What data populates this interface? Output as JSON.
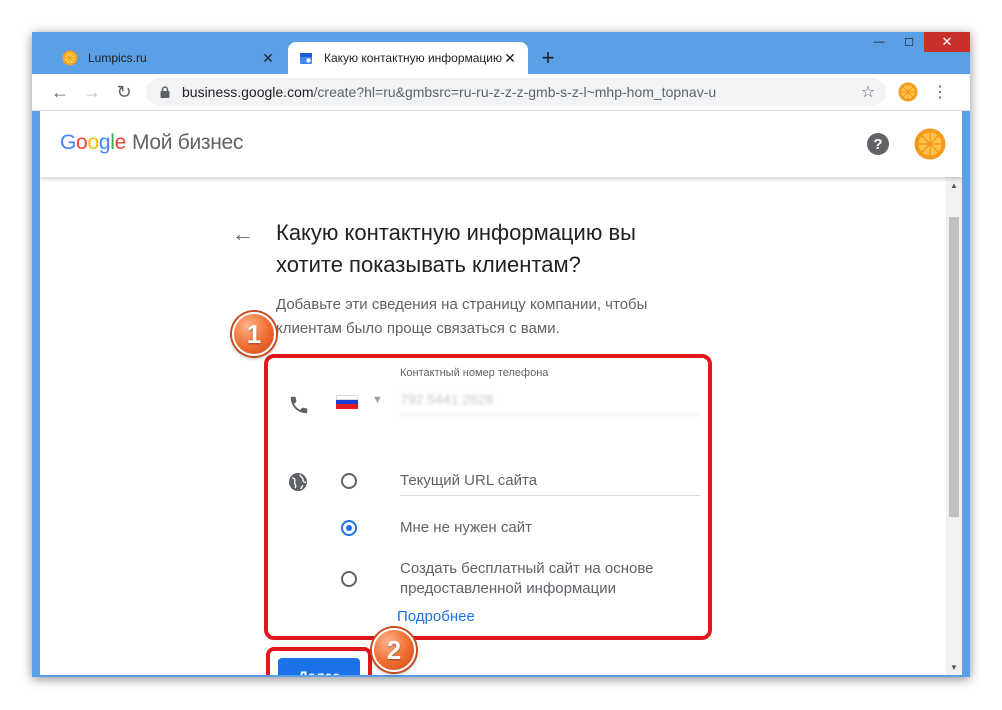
{
  "browser": {
    "tabs": [
      {
        "label": "Lumpics.ru",
        "active": false
      },
      {
        "label": "Какую контактную информацию",
        "active": true
      }
    ],
    "new_tab": "+",
    "url_host": "business.google.com",
    "url_rest": "/create?hl=ru&gmbsrc=ru-ru-z-z-z-gmb-s-z-l~mhp-hom_topnav-u",
    "window_controls": {
      "minimize": "—",
      "maximize": "☐",
      "close": "✕"
    }
  },
  "appbar": {
    "logo_letters": [
      "G",
      "o",
      "o",
      "g",
      "l",
      "e"
    ],
    "product": "Мой бизнес",
    "help": "?"
  },
  "form": {
    "heading": "Какую контактную информацию вы хотите показывать клиентам?",
    "subtext": "Добавьте эти сведения на страницу компании, чтобы клиентам было проще связаться с вами.",
    "phone_label": "Контактный номер телефона",
    "phone_value": "792 5441 2626",
    "website_options": [
      {
        "label": "Текущий URL сайта",
        "checked": false
      },
      {
        "label": "Мне не нужен сайт",
        "checked": true
      },
      {
        "label": "Создать бесплатный сайт на основе предоставленной информации",
        "checked": false
      }
    ],
    "more_link": "Подробнее",
    "next_button": "Далее"
  },
  "annotations": {
    "badge1": "1",
    "badge2": "2"
  },
  "colors": {
    "accent": "#1a73e8",
    "highlight": "#e0171b",
    "window_frame": "#5aa0e6"
  }
}
